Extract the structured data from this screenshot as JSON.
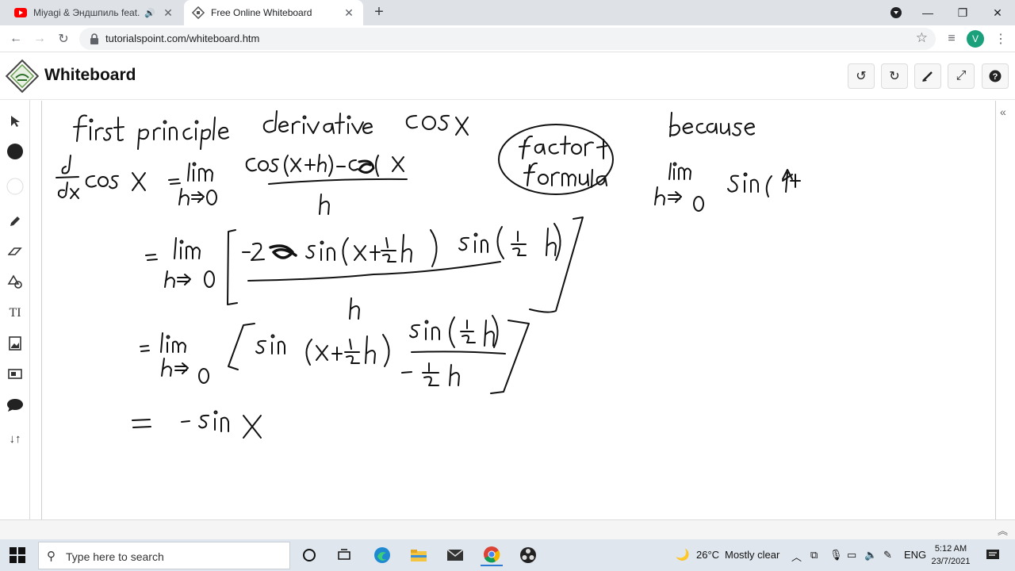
{
  "browser": {
    "tabs": [
      {
        "title": "Miyagi & Эндшпиль feat. Re",
        "active": false
      },
      {
        "title": "Free Online Whiteboard",
        "active": true
      }
    ],
    "url": "tutorialspoint.com/whiteboard.htm",
    "profile_initial": "V"
  },
  "app": {
    "title": "Whiteboard",
    "header_buttons": [
      "undo-icon",
      "redo-icon",
      "clear-brush-icon",
      "fullscreen-icon",
      "help-icon"
    ]
  },
  "tools": [
    "select-icon",
    "color-icon",
    "fill-white-icon",
    "pencil-icon",
    "eraser-icon",
    "shapes-icon",
    "text-icon",
    "image-icon",
    "screenshot-icon",
    "chat-icon",
    "sort-icon"
  ],
  "tool_text_label": "TI",
  "taskbar": {
    "search_placeholder": "Type here to search",
    "weather_temp": "26°C",
    "weather_desc": "Mostly clear",
    "language": "ENG",
    "time": "5:12 AM",
    "date": "23/7/2021"
  }
}
